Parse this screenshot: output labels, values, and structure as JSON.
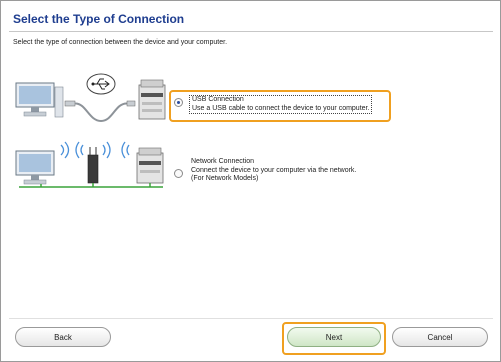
{
  "header": {
    "title": "Select the Type of Connection",
    "instruction": "Select the type of connection between the device and your computer."
  },
  "options": [
    {
      "title": "USB Connection",
      "description": "Use a USB cable to connect the device to your computer.",
      "note": "",
      "selected": true
    },
    {
      "title": "Network Connection",
      "description": "Connect the device to your computer via the network.",
      "note": "(For Network Models)",
      "selected": false
    }
  ],
  "footer": {
    "back_label": "Back",
    "next_label": "Next",
    "cancel_label": "Cancel"
  },
  "colors": {
    "title": "#1e3d8f",
    "highlight": "#f0a020",
    "next_button": "#cfe6c6",
    "network_line": "#3aa33a",
    "wifi_waves": "#4a90d9"
  },
  "icons": {
    "usb_illustration": [
      "computer-icon",
      "usb-cable-icon",
      "usb-symbol-icon",
      "printer-icon"
    ],
    "network_illustration": [
      "computer-icon",
      "wifi-router-icon",
      "wifi-waves-icon",
      "printer-icon"
    ]
  }
}
